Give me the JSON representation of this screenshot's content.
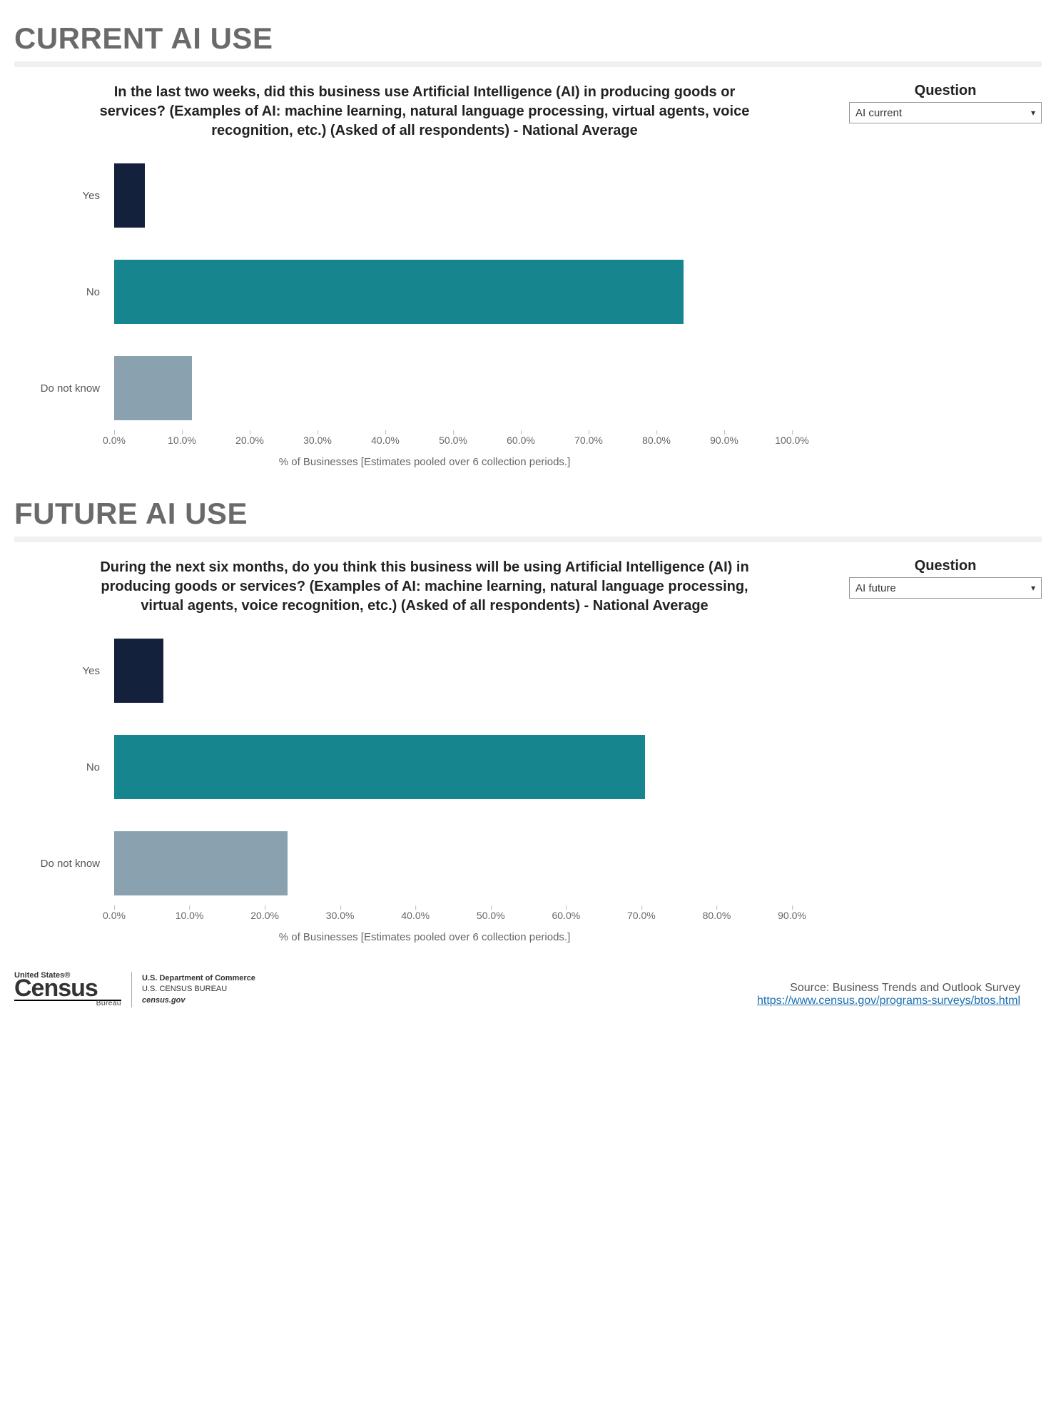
{
  "chart_data": [
    {
      "id": "current",
      "heading": "CURRENT AI USE",
      "type": "bar",
      "orientation": "horizontal",
      "title": "In the last two weeks, did this business use Artificial Intelligence (AI) in producing goods or services? (Examples of AI: machine learning, natural language processing, virtual agents, voice recognition, etc.) (Asked of all respondents) - National Average",
      "categories": [
        "Yes",
        "No",
        "Do not know"
      ],
      "values": [
        4.5,
        84.0,
        11.5
      ],
      "colors": [
        "#14213d",
        "#17858d",
        "#8aa1af"
      ],
      "xlabel": "% of Businesses [Estimates pooled over 6 collection periods.]",
      "ylabel": "",
      "xlim": [
        0,
        100
      ],
      "ticks": [
        "0.0%",
        "10.0%",
        "20.0%",
        "30.0%",
        "40.0%",
        "50.0%",
        "60.0%",
        "70.0%",
        "80.0%",
        "90.0%",
        "100.0%"
      ],
      "dropdown": {
        "label": "Question",
        "value": "AI current"
      }
    },
    {
      "id": "future",
      "heading": "FUTURE AI USE",
      "type": "bar",
      "orientation": "horizontal",
      "title": "During the next six months, do you think this business will be using Artificial Intelligence (AI) in producing goods or services? (Examples of AI: machine learning, natural language processing, virtual agents, voice recognition, etc.) (Asked of all respondents) - National Average",
      "categories": [
        "Yes",
        "No",
        "Do not know"
      ],
      "values": [
        6.5,
        70.5,
        23.0
      ],
      "colors": [
        "#14213d",
        "#17858d",
        "#8aa1af"
      ],
      "xlabel": "% of Businesses [Estimates pooled over 6 collection periods.]",
      "ylabel": "",
      "xlim": [
        0,
        90
      ],
      "ticks": [
        "0.0%",
        "10.0%",
        "20.0%",
        "30.0%",
        "40.0%",
        "50.0%",
        "60.0%",
        "70.0%",
        "80.0%",
        "90.0%"
      ],
      "dropdown": {
        "label": "Question",
        "value": "AI future"
      }
    }
  ],
  "footer": {
    "logo_top": "United States®",
    "logo_main": "Census",
    "logo_sub": "Bureau",
    "dept_l1": "U.S. Department of Commerce",
    "dept_l2": "U.S. CENSUS BUREAU",
    "dept_l3": "census.gov",
    "source": "Source: Business Trends and Outlook Survey",
    "link": "https://www.census.gov/programs-surveys/btos.html"
  }
}
